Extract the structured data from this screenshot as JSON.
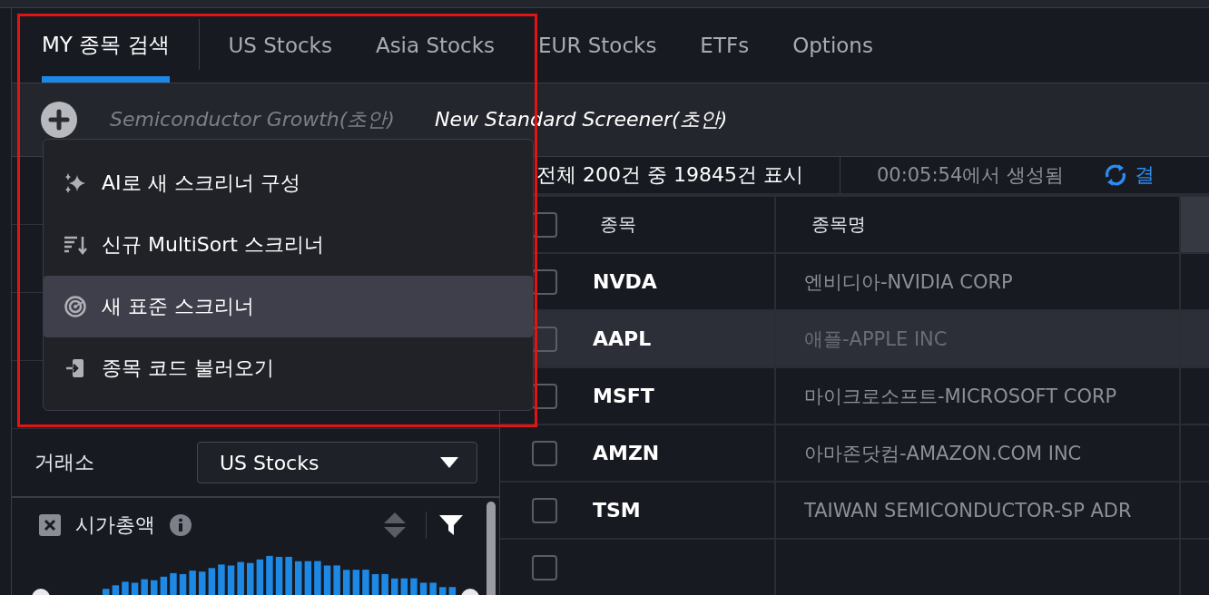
{
  "tabs": [
    {
      "label": "MY 종목 검색",
      "selected": true
    },
    {
      "label": "US Stocks",
      "selected": false
    },
    {
      "label": "Asia Stocks",
      "selected": false
    },
    {
      "label": "EUR Stocks",
      "selected": false
    },
    {
      "label": "ETFs",
      "selected": false
    },
    {
      "label": "Options",
      "selected": false
    }
  ],
  "screeners": [
    {
      "label": "Semiconductor Growth(초안)",
      "selected": false
    },
    {
      "label": "New Standard Screener(초안)",
      "selected": true
    }
  ],
  "menu": {
    "items": [
      {
        "kind": "ai",
        "label": "AI로 새 스크리너 구성",
        "highlighted": false
      },
      {
        "kind": "sort",
        "label": "신규 MultiSort 스크리너",
        "highlighted": false
      },
      {
        "kind": "standard",
        "label": "새 표준 스크리너",
        "highlighted": true
      },
      {
        "kind": "import",
        "label": "종목 코드 불러오기",
        "highlighted": false
      }
    ]
  },
  "exchange": {
    "label": "거래소",
    "value": "US Stocks"
  },
  "filter": {
    "label": "시가총액"
  },
  "status": {
    "count": "전체 200건 중 19845건 표시",
    "generated": "00:05:54에서 생성됨",
    "action": "결"
  },
  "table": {
    "select_all": {
      "checked": false
    },
    "columns": [
      "종목",
      "종목명"
    ],
    "partial_row": {
      "checked": false
    },
    "rows": [
      {
        "symbol": "NVDA",
        "name": "엔비디아-NVIDIA CORP",
        "highlighted": false,
        "checked": false
      },
      {
        "symbol": "AAPL",
        "name": "애플-APPLE INC",
        "highlighted": true,
        "checked": false
      },
      {
        "symbol": "MSFT",
        "name": "마이크로소프트-MICROSOFT CORP",
        "highlighted": false,
        "checked": false
      },
      {
        "symbol": "AMZN",
        "name": "아마존닷컴-AMAZON.COM INC",
        "highlighted": false,
        "checked": false
      },
      {
        "symbol": "TSM",
        "name": "TAIWAN SEMICONDUCTOR-SP ADR",
        "highlighted": false,
        "checked": false
      }
    ]
  }
}
